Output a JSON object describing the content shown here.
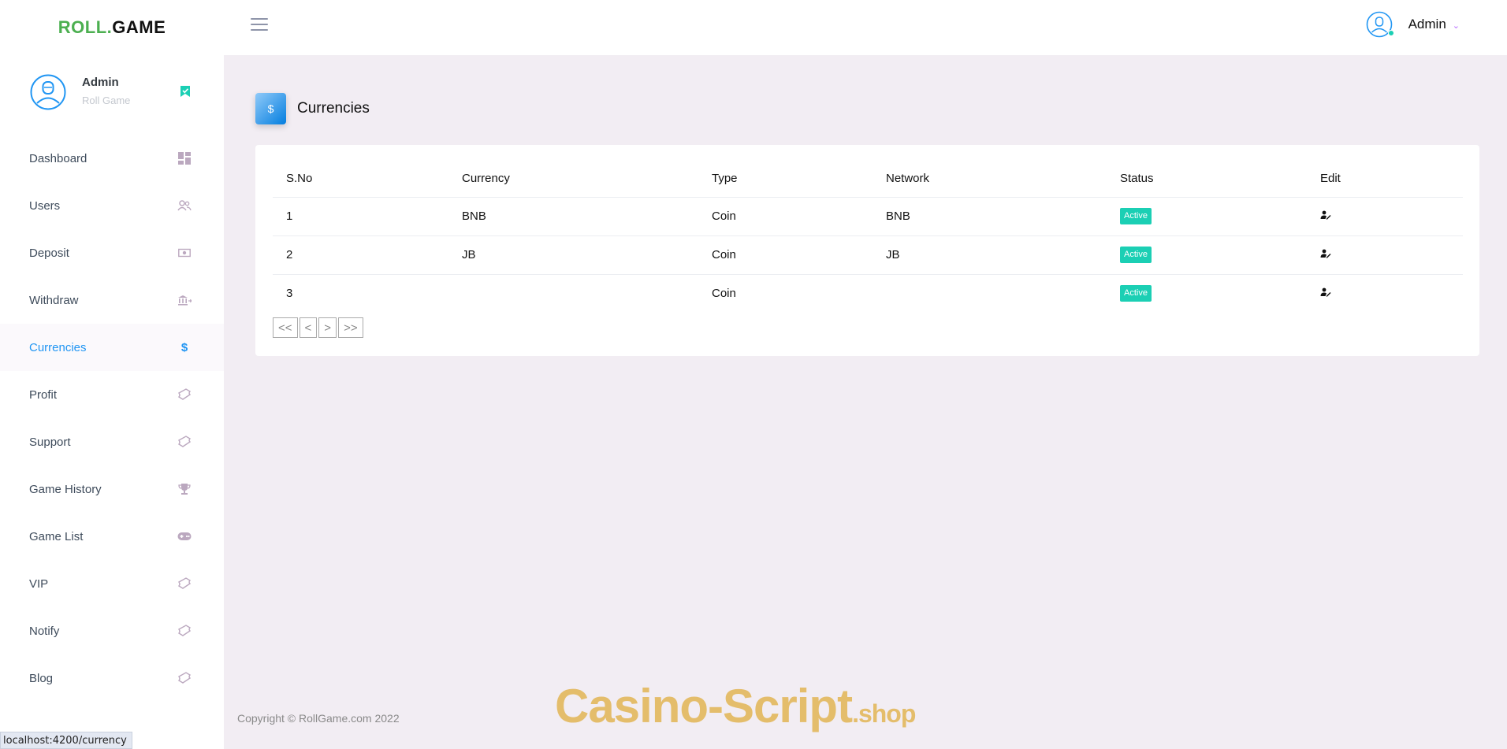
{
  "brand": {
    "logo_left": "ROLL.",
    "logo_right": "GAME"
  },
  "topbar": {
    "user_name": "Admin"
  },
  "sidebar": {
    "profile": {
      "name": "Admin",
      "subtitle": "Roll Game"
    },
    "items": [
      {
        "label": "Dashboard",
        "icon": "dashboard-icon"
      },
      {
        "label": "Users",
        "icon": "users-icon"
      },
      {
        "label": "Deposit",
        "icon": "cash-icon"
      },
      {
        "label": "Withdraw",
        "icon": "bank-icon"
      },
      {
        "label": "Currencies",
        "icon": "dollar-icon",
        "active": true
      },
      {
        "label": "Profit",
        "icon": "ticket-icon"
      },
      {
        "label": "Support",
        "icon": "ticket-icon"
      },
      {
        "label": "Game History",
        "icon": "trophy-icon"
      },
      {
        "label": "Game List",
        "icon": "gamepad-icon"
      },
      {
        "label": "VIP",
        "icon": "ticket-icon"
      },
      {
        "label": "Notify",
        "icon": "ticket-icon"
      },
      {
        "label": "Blog",
        "icon": "ticket-icon"
      }
    ]
  },
  "page": {
    "title": "Currencies",
    "icon_glyph": "$"
  },
  "table": {
    "headers": [
      "S.No",
      "Currency",
      "Type",
      "Network",
      "Status",
      "Edit"
    ],
    "rows": [
      {
        "sno": "1",
        "currency": "BNB",
        "type": "Coin",
        "network": "BNB",
        "status": "Active"
      },
      {
        "sno": "2",
        "currency": "JB",
        "type": "Coin",
        "network": "JB",
        "status": "Active"
      },
      {
        "sno": "3",
        "currency": "",
        "type": "Coin",
        "network": "",
        "status": "Active"
      }
    ]
  },
  "pager": {
    "first": "<<",
    "prev": "<",
    "next": ">",
    "last": ">>"
  },
  "footer": {
    "copyright": "Copyright © RollGame.com 2022"
  },
  "watermark": {
    "main": "Casino-Script",
    "suffix": ".shop"
  },
  "statusbar": {
    "url": "localhost:4200/currency"
  },
  "colors": {
    "accent": "#2196f3",
    "success": "#1bcfb4",
    "purple": "#b66dff",
    "background": "#f2edf3"
  }
}
